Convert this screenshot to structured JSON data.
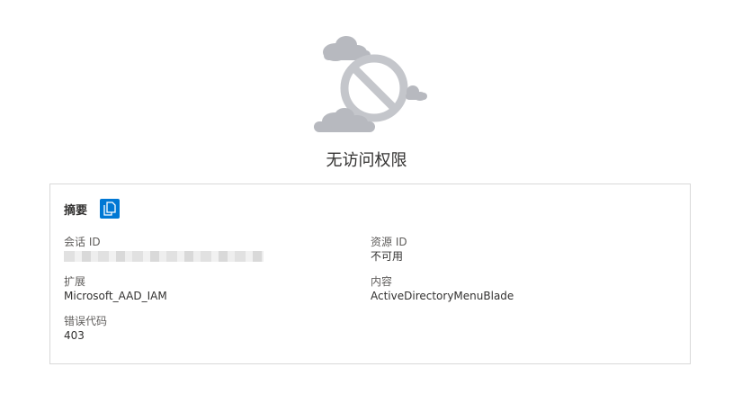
{
  "title": "无访问权限",
  "summary": {
    "heading": "摘要",
    "copy_icon": "copy-icon"
  },
  "fields": {
    "session_id": {
      "label": "会话 ID",
      "value": ""
    },
    "resource_id": {
      "label": "资源 ID",
      "value": "不可用"
    },
    "extension": {
      "label": "扩展",
      "value": "Microsoft_AAD_IAM"
    },
    "content": {
      "label": "内容",
      "value": "ActiveDirectoryMenuBlade"
    },
    "error_code": {
      "label": "错误代码",
      "value": "403"
    }
  },
  "colors": {
    "accent": "#0078d4",
    "illustration": "#b7b9bf",
    "border": "#d8d8d8"
  }
}
